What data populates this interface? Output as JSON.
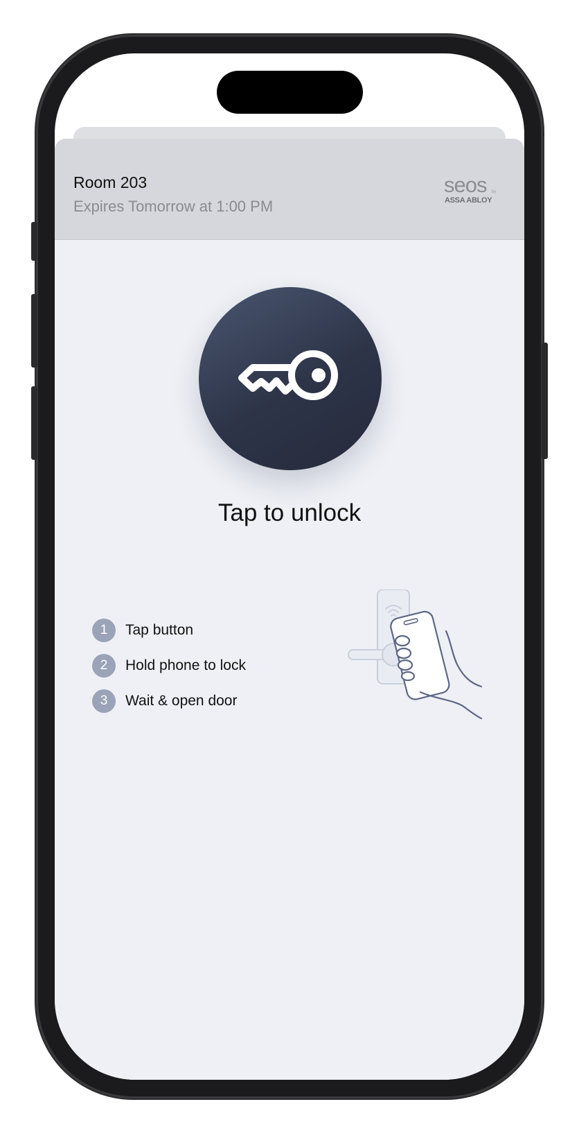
{
  "room": {
    "title": "Room 203",
    "expires": "Expires Tomorrow at 1:00 PM"
  },
  "brand": {
    "word": "seos",
    "tm": "by",
    "sub": "ASSA ABLOY"
  },
  "unlock": {
    "label": "Tap to unlock",
    "icon": "key-icon"
  },
  "steps": [
    {
      "num": "1",
      "text": "Tap button"
    },
    {
      "num": "2",
      "text": "Hold phone to lock"
    },
    {
      "num": "3",
      "text": "Wait & open door"
    }
  ],
  "colors": {
    "button_dark": "#2d3448",
    "sheet_bg": "#eef0f5",
    "header_bg": "#d6d7dc",
    "step_badge": "#9aa3b7"
  }
}
